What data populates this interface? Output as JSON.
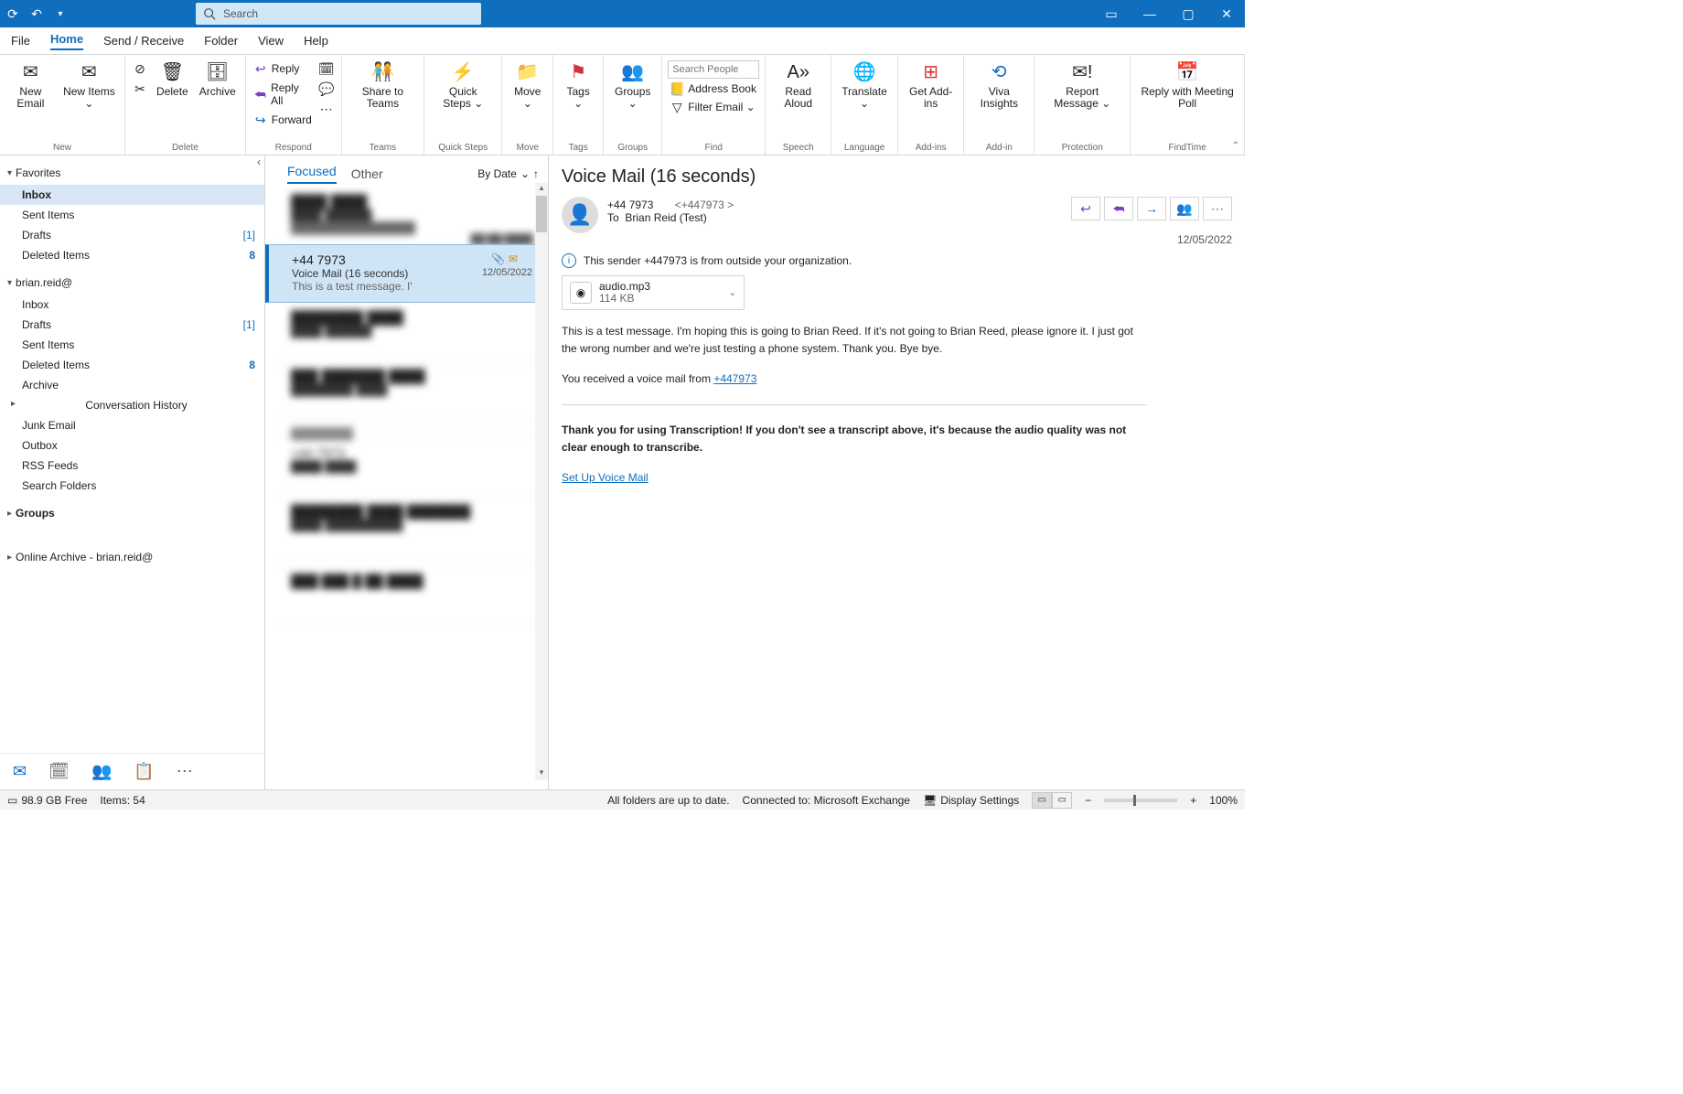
{
  "titlebar": {
    "search_placeholder": "Search"
  },
  "menubar": {
    "file": "File",
    "home": "Home",
    "send_receive": "Send / Receive",
    "folder": "Folder",
    "view": "View",
    "help": "Help"
  },
  "ribbon": {
    "new": {
      "new_email": "New\nEmail",
      "new_items": "New\nItems ⌄",
      "group": "New"
    },
    "delete": {
      "delete": "Delete",
      "archive": "Archive",
      "group": "Delete"
    },
    "respond": {
      "reply": "Reply",
      "reply_all": "Reply All",
      "forward": "Forward",
      "share_teams": "Share to\nTeams",
      "group": "Respond"
    },
    "teams": {
      "group": "Teams"
    },
    "quick": {
      "quick_steps": "Quick\nSteps ⌄",
      "group": "Quick Steps"
    },
    "move": {
      "move": "Move\n⌄",
      "group": "Move"
    },
    "tags": {
      "tags": "Tags\n⌄",
      "group": "Tags"
    },
    "groups": {
      "groups": "Groups\n⌄",
      "group": "Groups"
    },
    "find": {
      "search_people": "Search People",
      "address_book": "Address Book",
      "filter": "Filter Email ⌄",
      "group": "Find"
    },
    "speech": {
      "read_aloud": "Read\nAloud",
      "group": "Speech"
    },
    "lang": {
      "translate": "Translate\n⌄",
      "group": "Language"
    },
    "addins": {
      "get": "Get\nAdd-ins",
      "group": "Add-ins"
    },
    "viva": {
      "viva": "Viva\nInsights",
      "group": "Add-in"
    },
    "protect": {
      "report": "Report\nMessage ⌄",
      "group": "Protection"
    },
    "findtime": {
      "poll": "Reply with\nMeeting Poll",
      "group": "FindTime"
    }
  },
  "nav": {
    "favorites": "Favorites",
    "fav_items": [
      {
        "label": "Inbox",
        "count": "",
        "selected": true
      },
      {
        "label": "Sent Items",
        "count": ""
      },
      {
        "label": "Drafts",
        "count": "[1]"
      },
      {
        "label": "Deleted Items",
        "count": "8",
        "bold": true
      }
    ],
    "account": "brian.reid@",
    "acct_items": [
      {
        "label": "Inbox",
        "count": ""
      },
      {
        "label": "Drafts",
        "count": "[1]"
      },
      {
        "label": "Sent Items",
        "count": ""
      },
      {
        "label": "Deleted Items",
        "count": "8",
        "bold": true
      },
      {
        "label": "Archive",
        "count": ""
      },
      {
        "label": "Conversation History",
        "count": "",
        "chev": true
      },
      {
        "label": "Junk Email",
        "count": ""
      },
      {
        "label": "Outbox",
        "count": ""
      },
      {
        "label": "RSS Feeds",
        "count": ""
      },
      {
        "label": "Search Folders",
        "count": ""
      }
    ],
    "groups": "Groups",
    "online_archive": "Online Archive - brian.reid@"
  },
  "list": {
    "focused": "Focused",
    "other": "Other",
    "sort": "By Date",
    "selected": {
      "from": "+44 7973",
      "subject": "Voice Mail (16 seconds)",
      "preview": "This is a test message. I'",
      "date": "12/05/2022"
    }
  },
  "reading": {
    "subject": "Voice Mail (16 seconds)",
    "from_display": "+44 7973",
    "from_addr": "<+447973            >",
    "to_label": "To",
    "to": "Brian Reid (Test)",
    "date": "12/05/2022",
    "info": "This sender +447973              is from outside your organization.",
    "attach_name": "audio.mp3",
    "attach_size": "114 KB",
    "body": "This is a test message. I'm hoping this is going to Brian Reed. If it's not going to Brian Reed, please ignore it. I just got the wrong number and we're just testing a phone system. Thank you. Bye bye.",
    "received_prefix": "You received a voice mail from ",
    "received_link": "+447973",
    "trans_note": "Thank you for using Transcription! If you don't see a transcript above, it's because the audio quality was not clear enough to transcribe.",
    "setup_link": "Set Up Voice Mail"
  },
  "status": {
    "disk": "98.9 GB Free",
    "items": "Items: 54",
    "sync": "All folders are up to date.",
    "conn": "Connected to: Microsoft Exchange",
    "display": "Display Settings",
    "zoom": "100%"
  }
}
